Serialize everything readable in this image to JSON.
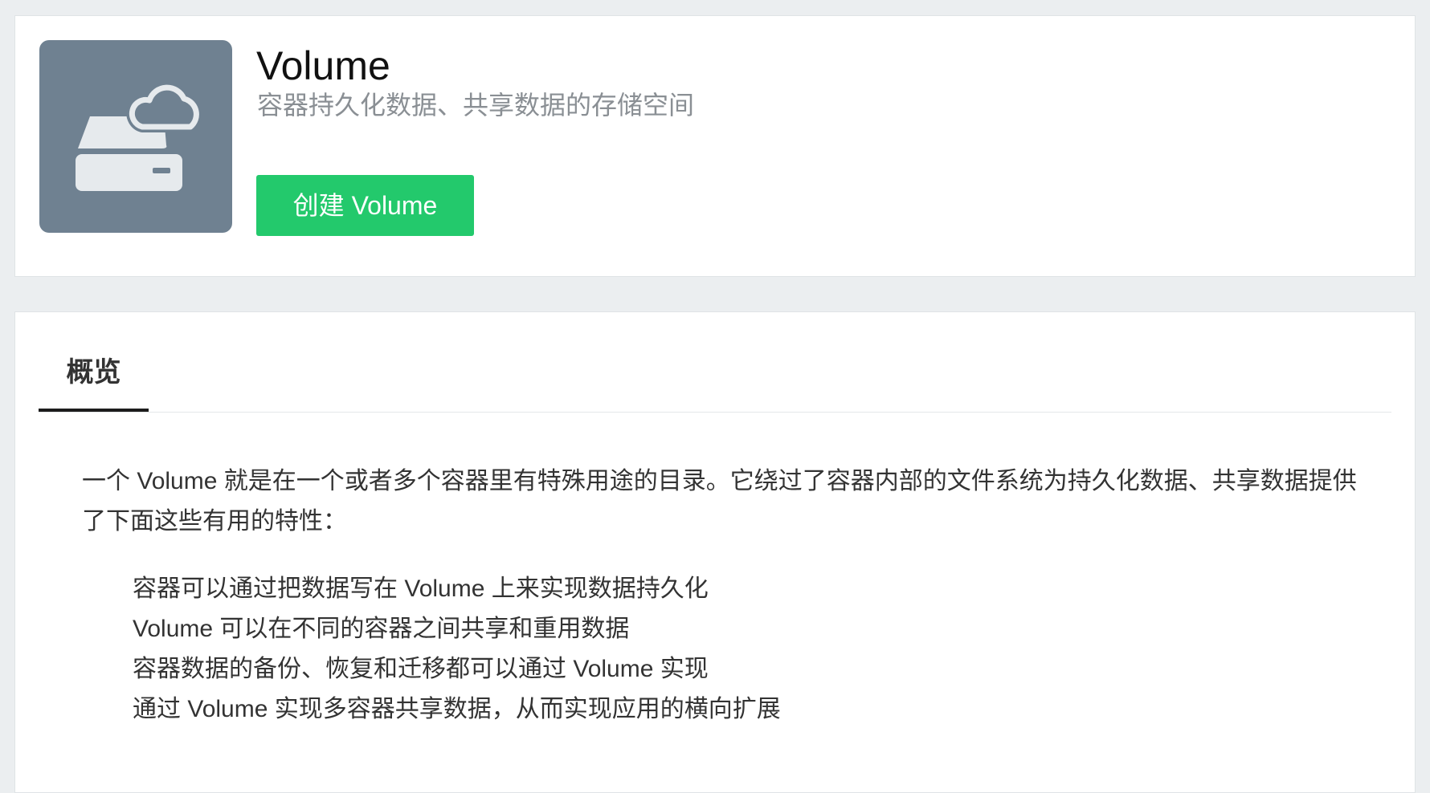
{
  "header": {
    "title": "Volume",
    "subtitle": "容器持久化数据、共享数据的存储空间",
    "create_button_label": "创建 Volume",
    "icon": "drive-cloud-icon"
  },
  "tabs": [
    {
      "label": "概览",
      "active": true
    }
  ],
  "overview": {
    "intro": "一个 Volume 就是在一个或者多个容器里有特殊用途的目录。它绕过了容器内部的文件系统为持久化数据、共享数据提供了下面这些有用的特性：",
    "features": [
      "容器可以通过把数据写在 Volume 上来实现数据持久化",
      "Volume 可以在不同的容器之间共享和重用数据",
      "容器数据的备份、恢复和迁移都可以通过 Volume 实现",
      "通过 Volume 实现多容器共享数据，从而实现应用的横向扩展"
    ]
  },
  "colors": {
    "accent_green": "#23c96c",
    "icon_background": "#6f8191",
    "page_background": "#ebeef0"
  }
}
